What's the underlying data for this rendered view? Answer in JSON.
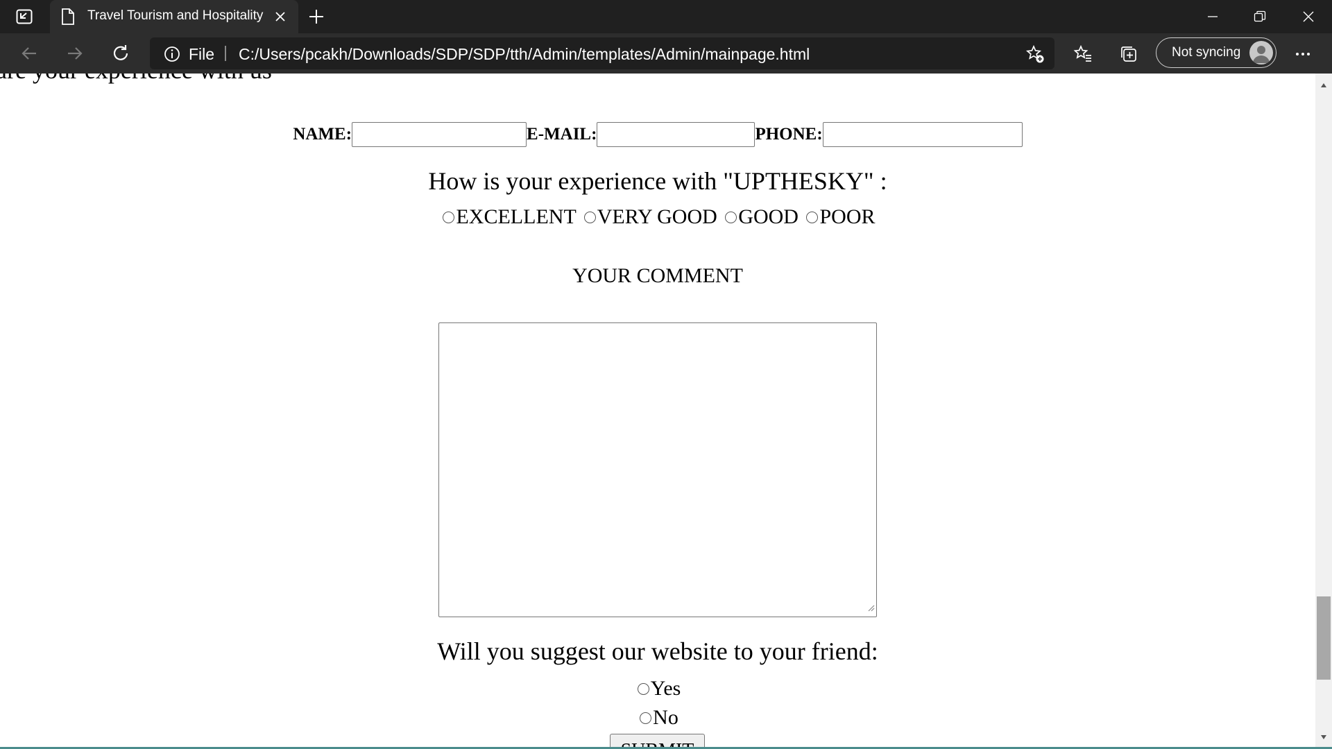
{
  "browser": {
    "tab_title": "Travel Tourism and Hospitality",
    "omnibox_scheme_label": "File",
    "url": "C:/Users/pcakh/Downloads/SDP/SDP/tth/Admin/templates/Admin/mainpage.html",
    "sync_label": "Not syncing"
  },
  "page": {
    "partial_heading": "are your experience with us",
    "name_label": "NAME:",
    "email_label": "E-MAIL:",
    "phone_label": "PHONE:",
    "name_value": "",
    "email_value": "",
    "phone_value": "",
    "experience_question": "How is your experience with \"UPTHESKY\" :",
    "experience_options": [
      "EXCELLENT",
      "VERY GOOD",
      "GOOD",
      "POOR"
    ],
    "comment_label": "YOUR COMMENT",
    "comment_value": "",
    "suggest_question": "Will you suggest our website to your friend:",
    "suggest_options": [
      "Yes",
      "No"
    ],
    "submit_label": "SUBMIT"
  },
  "colors": {
    "titlebar_bg": "#202020",
    "toolbar_bg": "#2d2d2d",
    "page_bg": "#ffffff",
    "scrollbar_thumb": "#a8a8a8"
  }
}
